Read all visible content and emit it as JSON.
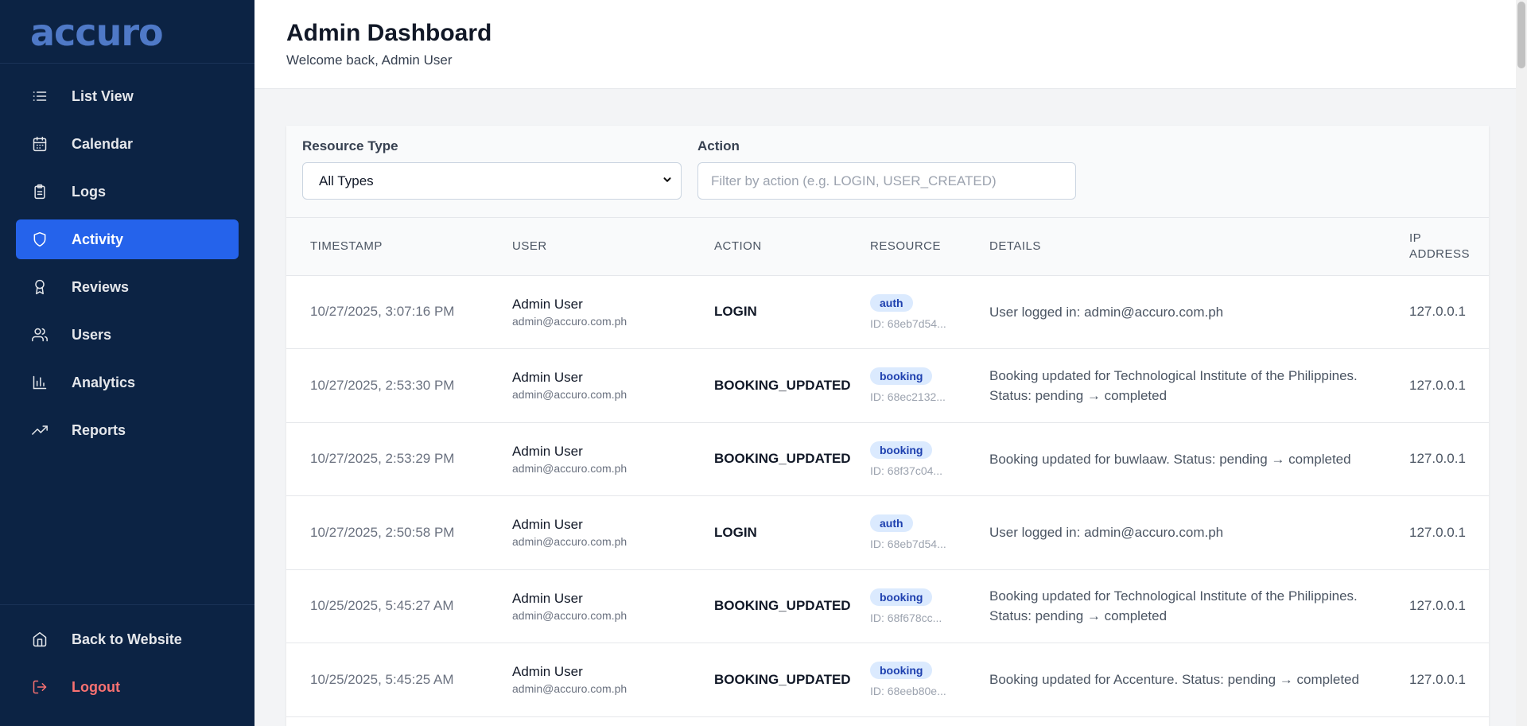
{
  "sidebar": {
    "logo": "accuro",
    "nav": [
      {
        "label": "List View",
        "icon": "list-icon"
      },
      {
        "label": "Calendar",
        "icon": "calendar-icon"
      },
      {
        "label": "Logs",
        "icon": "clipboard-icon"
      },
      {
        "label": "Activity",
        "icon": "shield-icon",
        "active": true
      },
      {
        "label": "Reviews",
        "icon": "award-icon"
      },
      {
        "label": "Users",
        "icon": "users-icon"
      },
      {
        "label": "Analytics",
        "icon": "bar-chart-icon"
      },
      {
        "label": "Reports",
        "icon": "trending-up-icon"
      }
    ],
    "bottom": [
      {
        "label": "Back to Website",
        "icon": "home-icon"
      },
      {
        "label": "Logout",
        "icon": "logout-icon"
      }
    ]
  },
  "header": {
    "title": "Admin Dashboard",
    "subtitle": "Welcome back, Admin User"
  },
  "filters": {
    "resource_type": {
      "label": "Resource Type",
      "value": "All Types"
    },
    "action": {
      "label": "Action",
      "placeholder": "Filter by action (e.g. LOGIN, USER_CREATED)"
    }
  },
  "table": {
    "headers": {
      "timestamp": "Timestamp",
      "user": "User",
      "action": "Action",
      "resource": "Resource",
      "details": "Details",
      "ip_line1": "IP",
      "ip_line2": "Address"
    },
    "rows": [
      {
        "timestamp": "10/27/2025, 3:07:16 PM",
        "user_name": "Admin User",
        "user_email": "admin@accuro.com.ph",
        "action": "LOGIN",
        "resource": "auth",
        "resource_id": "ID: 68eb7d54...",
        "details": "User logged in: admin@accuro.com.ph",
        "ip": "127.0.0.1"
      },
      {
        "timestamp": "10/27/2025, 2:53:30 PM",
        "user_name": "Admin User",
        "user_email": "admin@accuro.com.ph",
        "action": "BOOKING_UPDATED",
        "resource": "booking",
        "resource_id": "ID: 68ec2132...",
        "details": "Booking updated for Technological Institute of the Philippines. Status: pending → completed",
        "ip": "127.0.0.1"
      },
      {
        "timestamp": "10/27/2025, 2:53:29 PM",
        "user_name": "Admin User",
        "user_email": "admin@accuro.com.ph",
        "action": "BOOKING_UPDATED",
        "resource": "booking",
        "resource_id": "ID: 68f37c04...",
        "details": "Booking updated for buwlaaw. Status: pending → completed",
        "ip": "127.0.0.1"
      },
      {
        "timestamp": "10/27/2025, 2:50:58 PM",
        "user_name": "Admin User",
        "user_email": "admin@accuro.com.ph",
        "action": "LOGIN",
        "resource": "auth",
        "resource_id": "ID: 68eb7d54...",
        "details": "User logged in: admin@accuro.com.ph",
        "ip": "127.0.0.1"
      },
      {
        "timestamp": "10/25/2025, 5:45:27 AM",
        "user_name": "Admin User",
        "user_email": "admin@accuro.com.ph",
        "action": "BOOKING_UPDATED",
        "resource": "booking",
        "resource_id": "ID: 68f678cc...",
        "details": "Booking updated for Technological Institute of the Philippines. Status: pending → completed",
        "ip": "127.0.0.1"
      },
      {
        "timestamp": "10/25/2025, 5:45:25 AM",
        "user_name": "Admin User",
        "user_email": "admin@accuro.com.ph",
        "action": "BOOKING_UPDATED",
        "resource": "booking",
        "resource_id": "ID: 68eeb80e...",
        "details": "Booking updated for Accenture. Status: pending → completed",
        "ip": "127.0.0.1"
      }
    ]
  },
  "colors": {
    "sidebar_bg": "#0c2344",
    "active_nav": "#2563eb",
    "logout": "#f87171",
    "badge_bg": "#dbeafe",
    "badge_text": "#1e40af"
  }
}
